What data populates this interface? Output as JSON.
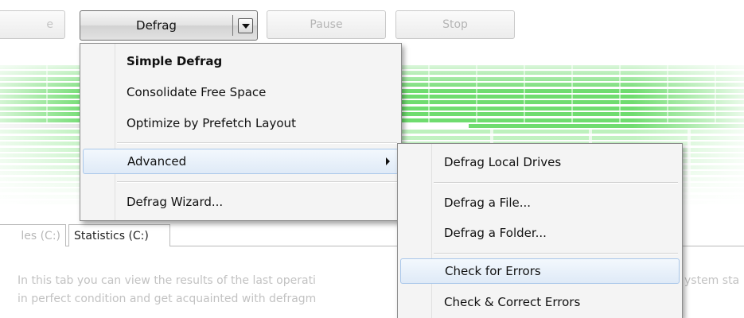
{
  "toolbar": {
    "partial_label": "e",
    "defrag_label": "Defrag",
    "pause_label": "Pause",
    "stop_label": "Stop"
  },
  "defrag_menu": {
    "items": [
      {
        "label": "Simple Defrag",
        "bold": true
      },
      {
        "label": "Consolidate Free Space"
      },
      {
        "label": "Optimize by Prefetch Layout"
      },
      {
        "label": "Advanced",
        "has_submenu": true,
        "highlighted": true
      },
      {
        "label": "Defrag Wizard..."
      }
    ]
  },
  "advanced_submenu": {
    "items": [
      {
        "label": "Defrag Local Drives"
      },
      {
        "label": "Defrag a File..."
      },
      {
        "label": "Defrag a Folder..."
      },
      {
        "label": "Check for Errors",
        "highlighted": true
      },
      {
        "label": "Check & Correct Errors"
      }
    ]
  },
  "tabs": [
    {
      "label": "les (C:)"
    },
    {
      "label": "Statistics (C:)",
      "selected": true
    }
  ],
  "description": {
    "line1_left": "In this tab you can view the results of the last operati",
    "line1_right": "ystem sta",
    "line2_left": "in perfect condition and get acquainted with defragm"
  },
  "colors": {
    "cluster_green": "#6fdc6f",
    "cluster_green_light": "#b9f0b9",
    "menu_highlight_border": "#a9c7ea",
    "menu_background": "#f4f4f4"
  }
}
